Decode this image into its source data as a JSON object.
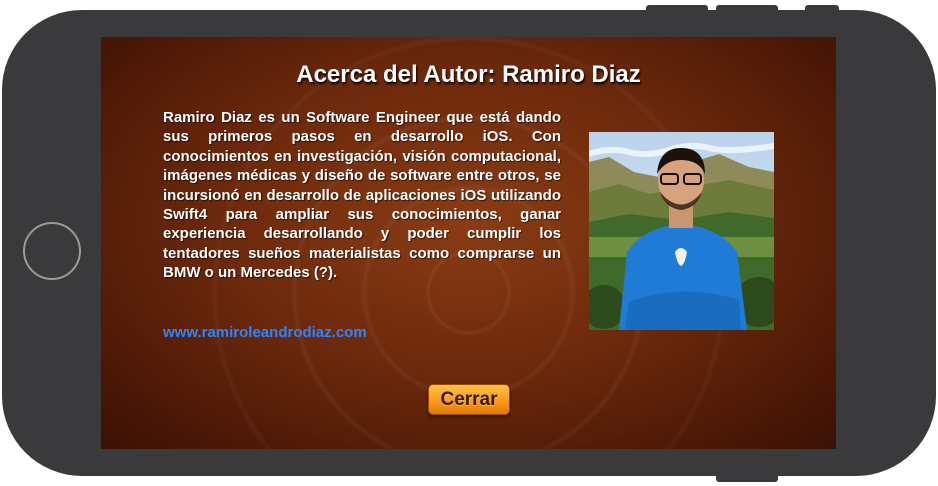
{
  "dialog": {
    "title": "Acerca del Autor: Ramiro Diaz",
    "bio": "Ramiro Diaz es un Software Engineer que está dando sus primeros pasos en desarrollo iOS. Con conocimientos en investigación, visión computacional, imágenes médicas y diseño de software entre otros, se incursionó en desarrollo de aplicaciones iOS utilizando Swift4 para ampliar sus conocimientos, ganar experiencia desarrollando y poder cumplir los tentadores sueños materialistas como comprarse un BMW o un Mercedes (?).",
    "website": "www.ramiroleandrodiaz.com",
    "close_label": "Cerrar",
    "photo": "author-photo"
  },
  "colors": {
    "background": "#6e2a0c",
    "link": "#2a86ff",
    "button": "#f99a1c",
    "phone_frame": "#3a3a3c"
  }
}
